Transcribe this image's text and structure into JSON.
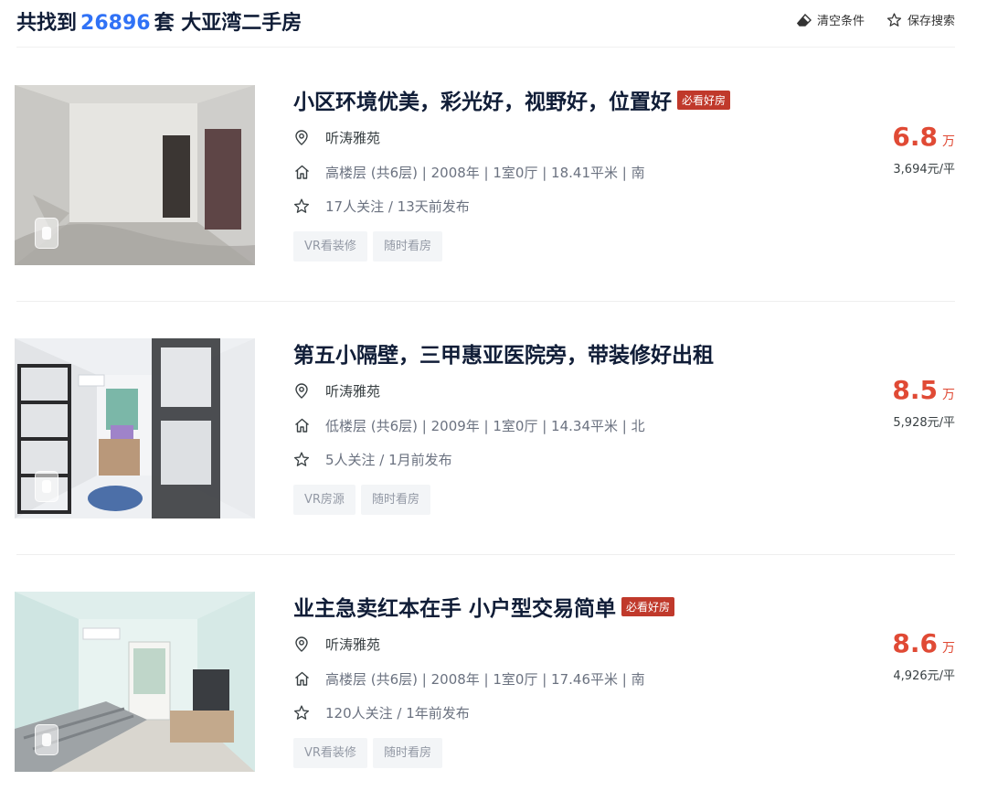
{
  "header": {
    "count_prefix": "共找到",
    "count": "26896",
    "count_suffix": "套 大亚湾二手房",
    "clear_label": "清空条件",
    "save_label": "保存搜索"
  },
  "listings": [
    {
      "title": "小区环境优美，彩光好，视野好，位置好",
      "badge": "必看好房",
      "community": "听涛雅苑",
      "details": "高楼层 (共6层) | 2008年 | 1室0厅 | 18.41平米 | 南",
      "follow": "17人关注 / 13天前发布",
      "tags": [
        "VR看装修",
        "随时看房"
      ],
      "total_price": "6.8",
      "price_unit": "万",
      "unit_price": "3,694元/平"
    },
    {
      "title": "第五小隔壁，三甲惠亚医院旁，带装修好出租",
      "badge": "",
      "community": "听涛雅苑",
      "details": "低楼层 (共6层) | 2009年 | 1室0厅 | 14.34平米 | 北",
      "follow": "5人关注 / 1月前发布",
      "tags": [
        "VR房源",
        "随时看房"
      ],
      "total_price": "8.5",
      "price_unit": "万",
      "unit_price": "5,928元/平"
    },
    {
      "title": "业主急卖红本在手 小户型交易简单",
      "badge": "必看好房",
      "community": "听涛雅苑",
      "details": "高楼层 (共6层) | 2008年 | 1室0厅 | 17.46平米 | 南",
      "follow": "120人关注 / 1年前发布",
      "tags": [
        "VR看装修",
        "随时看房"
      ],
      "total_price": "8.6",
      "price_unit": "万",
      "unit_price": "4,926元/平"
    }
  ],
  "colors": {
    "accent_blue": "#3072f6",
    "price_red": "#e04a35",
    "badge_red": "#c0392b"
  }
}
